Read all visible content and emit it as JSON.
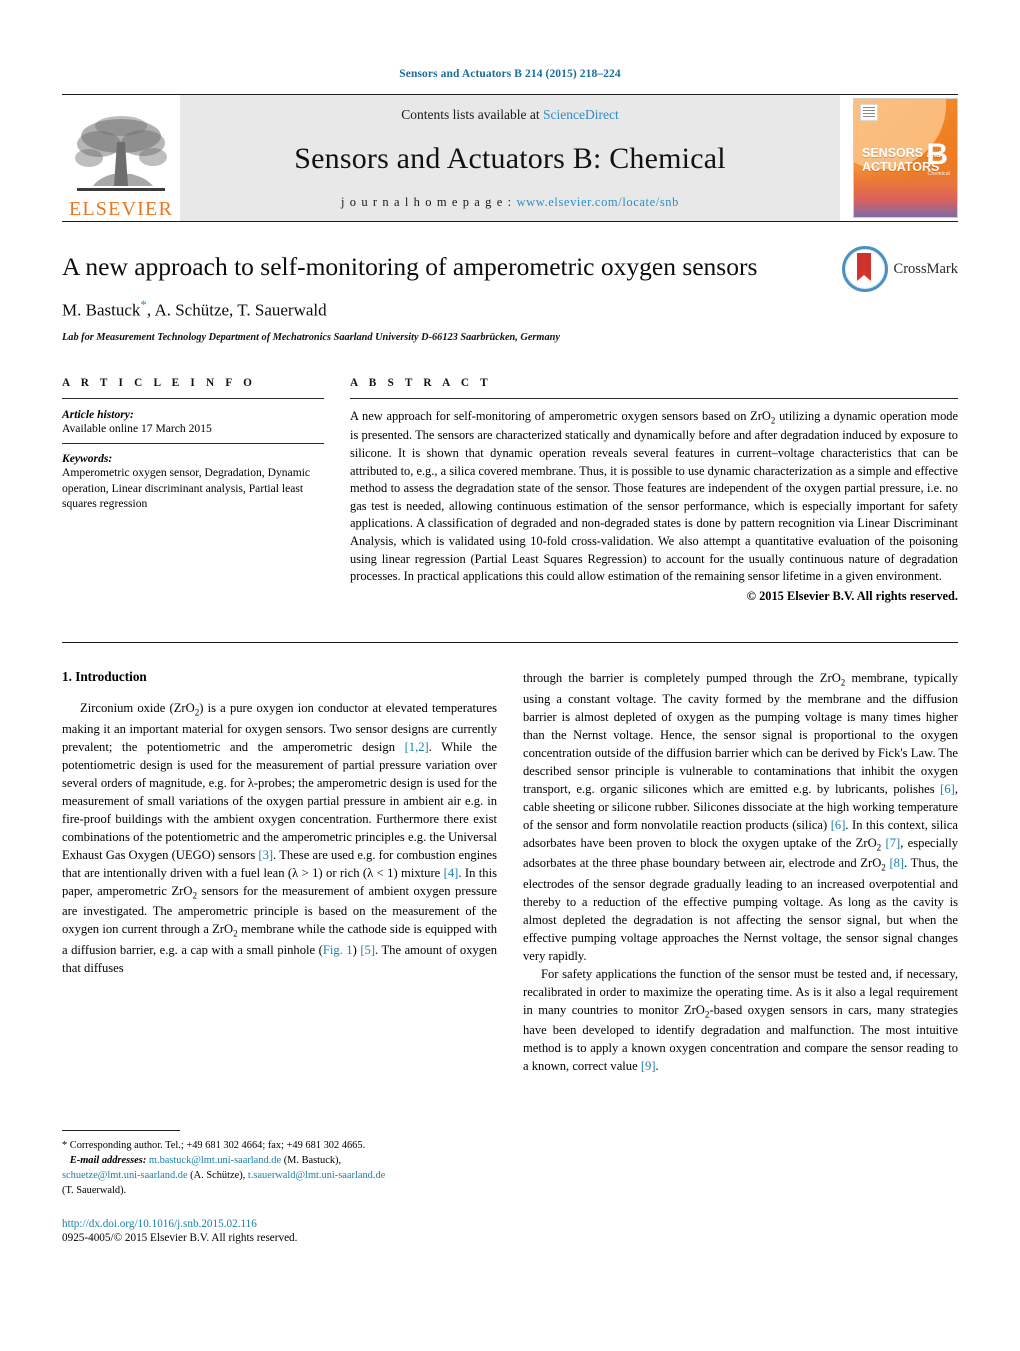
{
  "running_head": "Sensors and Actuators B 214 (2015) 218–224",
  "masthead": {
    "contents_prefix": "Contents lists available at ",
    "contents_link": "ScienceDirect",
    "journal_title": "Sensors and Actuators B: Chemical",
    "homepage_prefix": "j o u r n a l   h o m e p a g e :  ",
    "homepage_url": "www.elsevier.com/locate/snb",
    "publisher": "ELSEVIER",
    "cover": {
      "line1": "SENSORS",
      "and": "and",
      "line2": "ACTUATORS",
      "letter": "B",
      "sub": "Chemical"
    },
    "link_color": "#2e8fc0",
    "publisher_color": "#E87722"
  },
  "article": {
    "title": "A new approach to self-monitoring of amperometric oxygen sensors",
    "authors": "M. Bastuck",
    "authors_rest": ", A. Schütze, T. Sauerwald",
    "corresponding_marker": "*",
    "affiliation": "Lab for Measurement Technology Department of Mechatronics Saarland University D-66123 Saarbrücken, Germany",
    "crossmark_label": "CrossMark"
  },
  "article_info": {
    "heading": "A R T I C L E   I N F O",
    "history_label": "Article history:",
    "history_value": "Available online 17 March 2015",
    "keywords_label": "Keywords:",
    "keywords_value": "Amperometric oxygen sensor, Degradation, Dynamic operation, Linear discriminant analysis, Partial least squares regression"
  },
  "abstract": {
    "heading": "A B S T R A C T",
    "text": "A new approach for self-monitoring of amperometric oxygen sensors based on ZrO2 utilizing a dynamic operation mode is presented. The sensors are characterized statically and dynamically before and after degradation induced by exposure to silicone. It is shown that dynamic operation reveals several features in current–voltage characteristics that can be attributed to, e.g., a silica covered membrane. Thus, it is possible to use dynamic characterization as a simple and effective method to assess the degradation state of the sensor. Those features are independent of the oxygen partial pressure, i.e. no gas test is needed, allowing continuous estimation of the sensor performance, which is especially important for safety applications. A classification of degraded and non-degraded states is done by pattern recognition via Linear Discriminant Analysis, which is validated using 10-fold cross-validation. We also attempt a quantitative evaluation of the poisoning using linear regression (Partial Least Squares Regression) to account for the usually continuous nature of degradation processes. In practical applications this could allow estimation of the remaining sensor lifetime in a given environment.",
    "copyright": "© 2015 Elsevier B.V. All rights reserved."
  },
  "body": {
    "section_number_title": "1.  Introduction",
    "left_paragraph_1": "Zirconium oxide (ZrO2) is a pure oxygen ion conductor at elevated temperatures making it an important material for oxygen sensors. Two sensor designs are currently prevalent; the potentiometric and the amperometric design [1,2]. While the potentiometric design is used for the measurement of partial pressure variation over several orders of magnitude, e.g. for λ-probes; the amperometric design is used for the measurement of small variations of the oxygen partial pressure in ambient air e.g. in fire-proof buildings with the ambient oxygen concentration. Furthermore there exist combinations of the potentiometric and the amperometric principles e.g. the Universal Exhaust Gas Oxygen (UEGO) sensors [3]. These are used e.g. for combustion engines that are intentionally driven with a fuel lean (λ > 1) or rich (λ < 1) mixture [4]. In this paper, amperometric ZrO2 sensors for the measurement of ambient oxygen pressure are investigated. The amperometric principle is based on the measurement of the oxygen ion current through a ZrO2 membrane while the cathode side is equipped with a diffusion barrier, e.g. a cap with a small pinhole (Fig. 1) [5]. The amount of oxygen that diffuses",
    "right_paragraph_1": "through the barrier is completely pumped through the ZrO2 membrane, typically using a constant voltage. The cavity formed by the membrane and the diffusion barrier is almost depleted of oxygen as the pumping voltage is many times higher than the Nernst voltage. Hence, the sensor signal is proportional to the oxygen concentration outside of the diffusion barrier which can be derived by Fick's Law. The described sensor principle is vulnerable to contaminations that inhibit the oxygen transport, e.g. organic silicones which are emitted e.g. by lubricants, polishes [6], cable sheeting or silicone rubber. Silicones dissociate at the high working temperature of the sensor and form nonvolatile reaction products (silica) [6]. In this context, silica adsorbates have been proven to block the oxygen uptake of the ZrO2 [7], especially adsorbates at the three phase boundary between air, electrode and ZrO2 [8]. Thus, the electrodes of the sensor degrade gradually leading to an increased overpotential and thereby to a reduction of the effective pumping voltage. As long as the cavity is almost depleted the degradation is not affecting the sensor signal, but when the effective pumping voltage approaches the Nernst voltage, the sensor signal changes very rapidly.",
    "right_paragraph_2": "For safety applications the function of the sensor must be tested and, if necessary, recalibrated in order to maximize the operating time. As is it also a legal requirement in many countries to monitor ZrO2-based oxygen sensors in cars, many strategies have been developed to identify degradation and malfunction. The most intuitive method is to apply a known oxygen concentration and compare the sensor reading to a known, correct value [9]."
  },
  "footnote": {
    "star": "*",
    "corresponding": " Corresponding author. Tel.; +49 681 302 4664; fax; +49 681 302 4665.",
    "email_label": "E-mail addresses:",
    "email1": "m.bastuck@lmt.uni-saarland.de",
    "email1_name": " (M. Bastuck),",
    "email2": "schuetze@lmt.uni-saarland.de",
    "email2_name": " (A. Schütze),",
    "email3": "t.sauerwald@lmt.uni-saarland.de",
    "email3_name": "(T. Sauerwald)."
  },
  "doi": {
    "url": "http://dx.doi.org/10.1016/j.snb.2015.02.116",
    "issn": "0925-4005/© 2015 Elsevier B.V. All rights reserved."
  }
}
